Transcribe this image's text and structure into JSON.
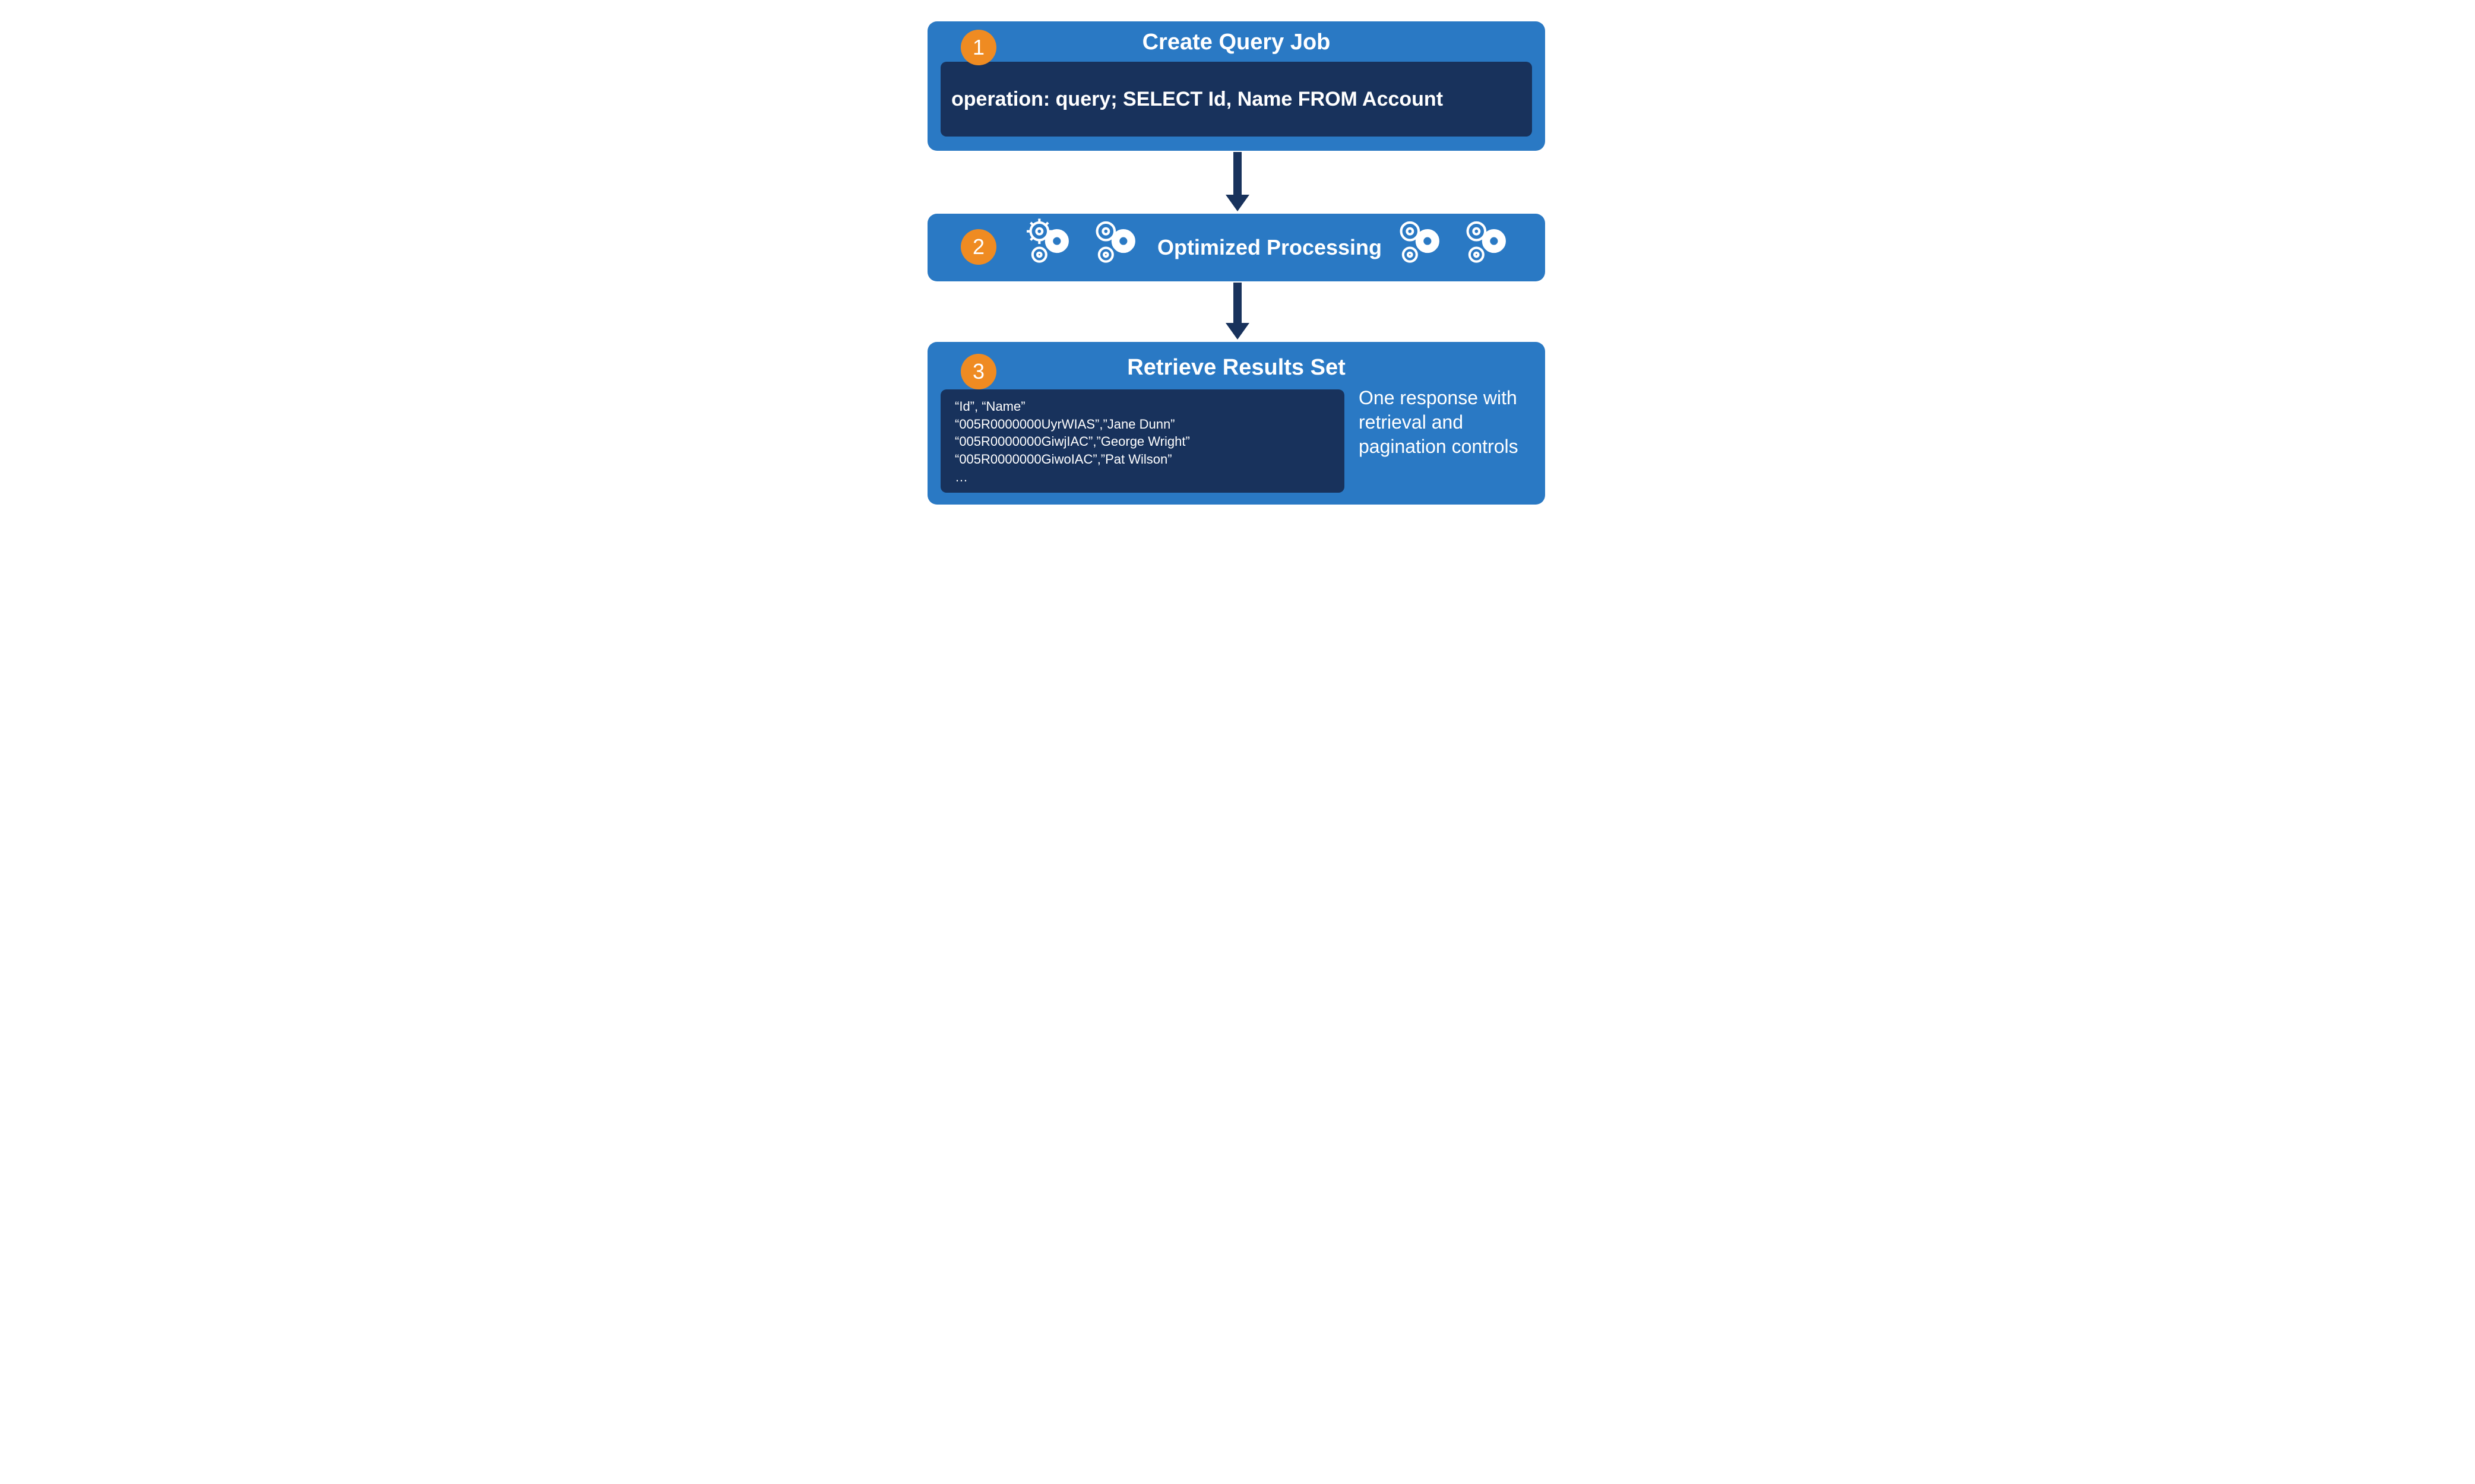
{
  "colors": {
    "panel": "#2a79c4",
    "dark": "#18325c",
    "badge": "#ef8b22"
  },
  "step1": {
    "num": "1",
    "title": "Create Query Job",
    "code": "operation: query; SELECT Id, Name FROM Account"
  },
  "step2": {
    "num": "2",
    "title": "Optimized Processing"
  },
  "step3": {
    "num": "3",
    "title": "Retrieve Results Set",
    "lines": {
      "l0": "“Id”, “Name”",
      "l1": "“005R0000000UyrWIAS”,”Jane Dunn”",
      "l2": "“005R0000000GiwjIAC”,”George Wright”",
      "l3": "“005R0000000GiwoIAC”,”Pat Wilson”",
      "l4": "…"
    },
    "note": "One response with retrieval and pagination controls"
  }
}
